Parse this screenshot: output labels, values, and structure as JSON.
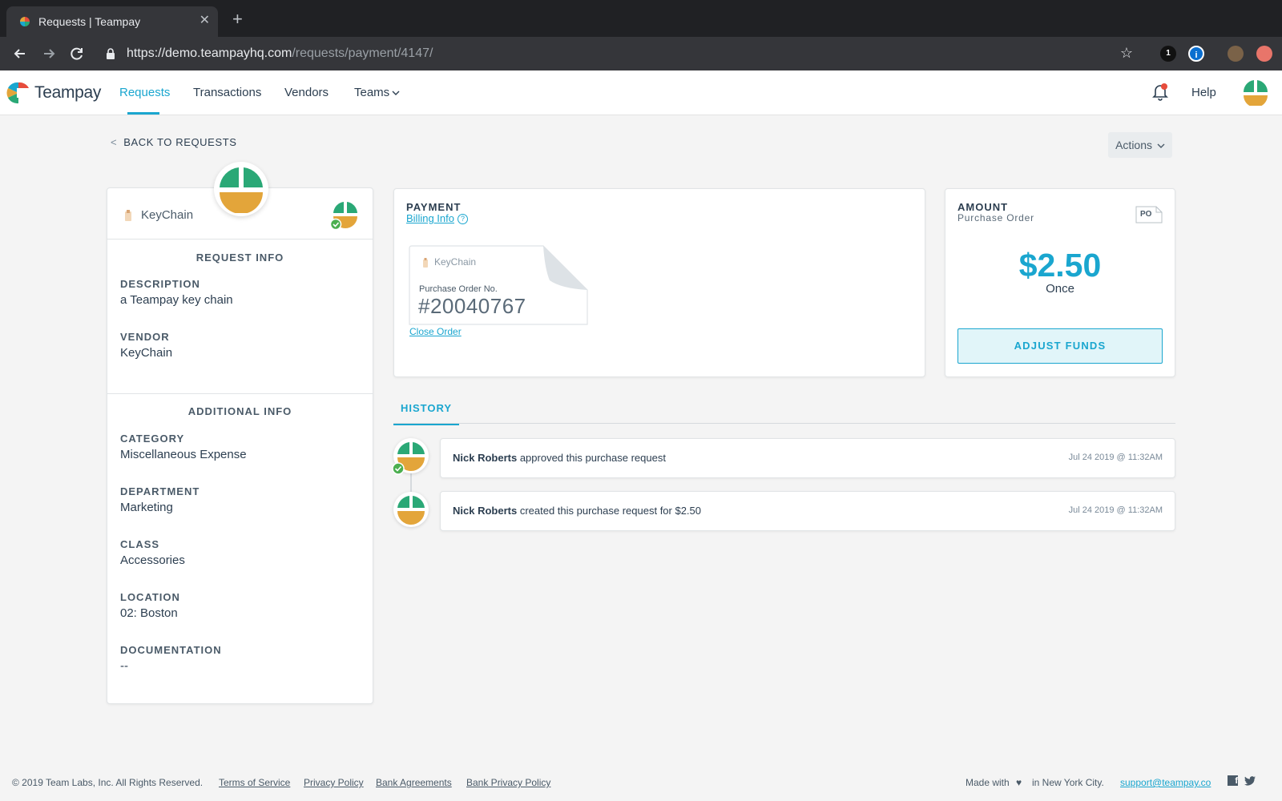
{
  "browser": {
    "tab_title": "Requests | Teampay",
    "tab_close": "✕",
    "new_tab": "+",
    "url_host": "https://demo.teampayhq.com",
    "url_path": "/requests/payment/4147/",
    "star": "☆",
    "ext1_label": "1",
    "ext2_label": "i"
  },
  "header": {
    "logo_text": "Teampay",
    "nav": {
      "requests": "Requests",
      "transactions": "Transactions",
      "vendors": "Vendors",
      "teams": "Teams"
    },
    "help": "Help"
  },
  "page": {
    "back": "BACK TO REQUESTS",
    "actions": "Actions"
  },
  "request": {
    "vendor_header": "KeyChain",
    "request_info_title": "REQUEST INFO",
    "description_label": "DESCRIPTION",
    "description_value": "a Teampay key chain",
    "vendor_label": "VENDOR",
    "vendor_value": "KeyChain",
    "additional_info_title": "ADDITIONAL INFO",
    "category_label": "CATEGORY",
    "category_value": "Miscellaneous Expense",
    "department_label": "DEPARTMENT",
    "department_value": "Marketing",
    "class_label": "CLASS",
    "class_value": "Accessories",
    "location_label": "LOCATION",
    "location_value": "02: Boston",
    "documentation_label": "DOCUMENTATION",
    "documentation_value": "--"
  },
  "payment": {
    "title": "PAYMENT",
    "billing_link": "Billing Info",
    "help_glyph": "?",
    "po_vendor": "KeyChain",
    "po_label": "Purchase Order No.",
    "po_number": "#20040767",
    "close_order": "Close Order"
  },
  "amount": {
    "title": "AMOUNT",
    "subtitle": "Purchase Order",
    "po_badge": "PO",
    "value": "$2.50",
    "frequency": "Once",
    "adjust_button": "ADJUST FUNDS"
  },
  "history": {
    "tab_label": "HISTORY",
    "entries": [
      {
        "actor": "Nick Roberts",
        "action": " approved this purchase request",
        "time": "Jul 24 2019 @ 11:32AM"
      },
      {
        "actor": "Nick Roberts",
        "action": " created this purchase request for $2.50",
        "time": "Jul 24 2019 @ 11:32AM"
      }
    ]
  },
  "footer": {
    "copyright": "© 2019 Team Labs, Inc. All Rights Reserved.",
    "terms": "Terms of Service",
    "privacy": "Privacy Policy",
    "bank_agreements": "Bank Agreements",
    "bank_privacy": "Bank Privacy Policy",
    "made_with": "Made with",
    "heart": "♥",
    "city": "in New York City.",
    "support": "support@teampay.co",
    "facebook": "f"
  },
  "colors": {
    "accent": "#1aa6cf",
    "avatar_green": "#2aa876",
    "avatar_gold": "#e3a53a",
    "check_green": "#4caf50",
    "notification_red": "#e74c3c"
  }
}
